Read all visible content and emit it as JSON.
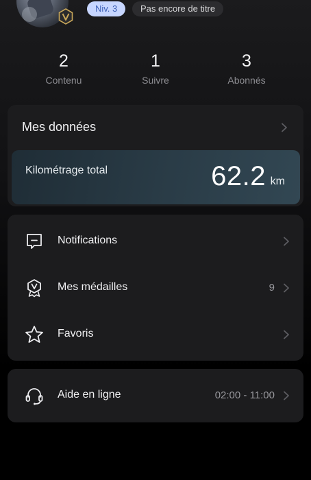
{
  "header": {
    "level": "Niv. 3",
    "title_status": "Pas encore de titre",
    "vip_badge_letter": "V"
  },
  "stats": [
    {
      "value": "2",
      "label": "Contenu"
    },
    {
      "value": "1",
      "label": "Suivre"
    },
    {
      "value": "3",
      "label": "Abonnés"
    }
  ],
  "data_card": {
    "title": "Mes données",
    "mileage_label": "Kilométrage total",
    "mileage_value": "62.2",
    "mileage_unit": "km"
  },
  "menu": [
    {
      "label": "Notifications",
      "meta": "",
      "icon": "notification-icon"
    },
    {
      "label": "Mes médailles",
      "meta": "9",
      "icon": "medal-icon"
    },
    {
      "label": "Favoris",
      "meta": "",
      "icon": "star-icon"
    }
  ],
  "help": {
    "label": "Aide en ligne",
    "hours": "02:00 - 11:00",
    "icon": "headset-icon"
  },
  "colors": {
    "background": "#000000",
    "card": "#1c1c1e",
    "level_pill_bg": "#c7d6ff",
    "level_pill_text": "#3c5fb6",
    "secondary_text": "#8d8d92"
  }
}
